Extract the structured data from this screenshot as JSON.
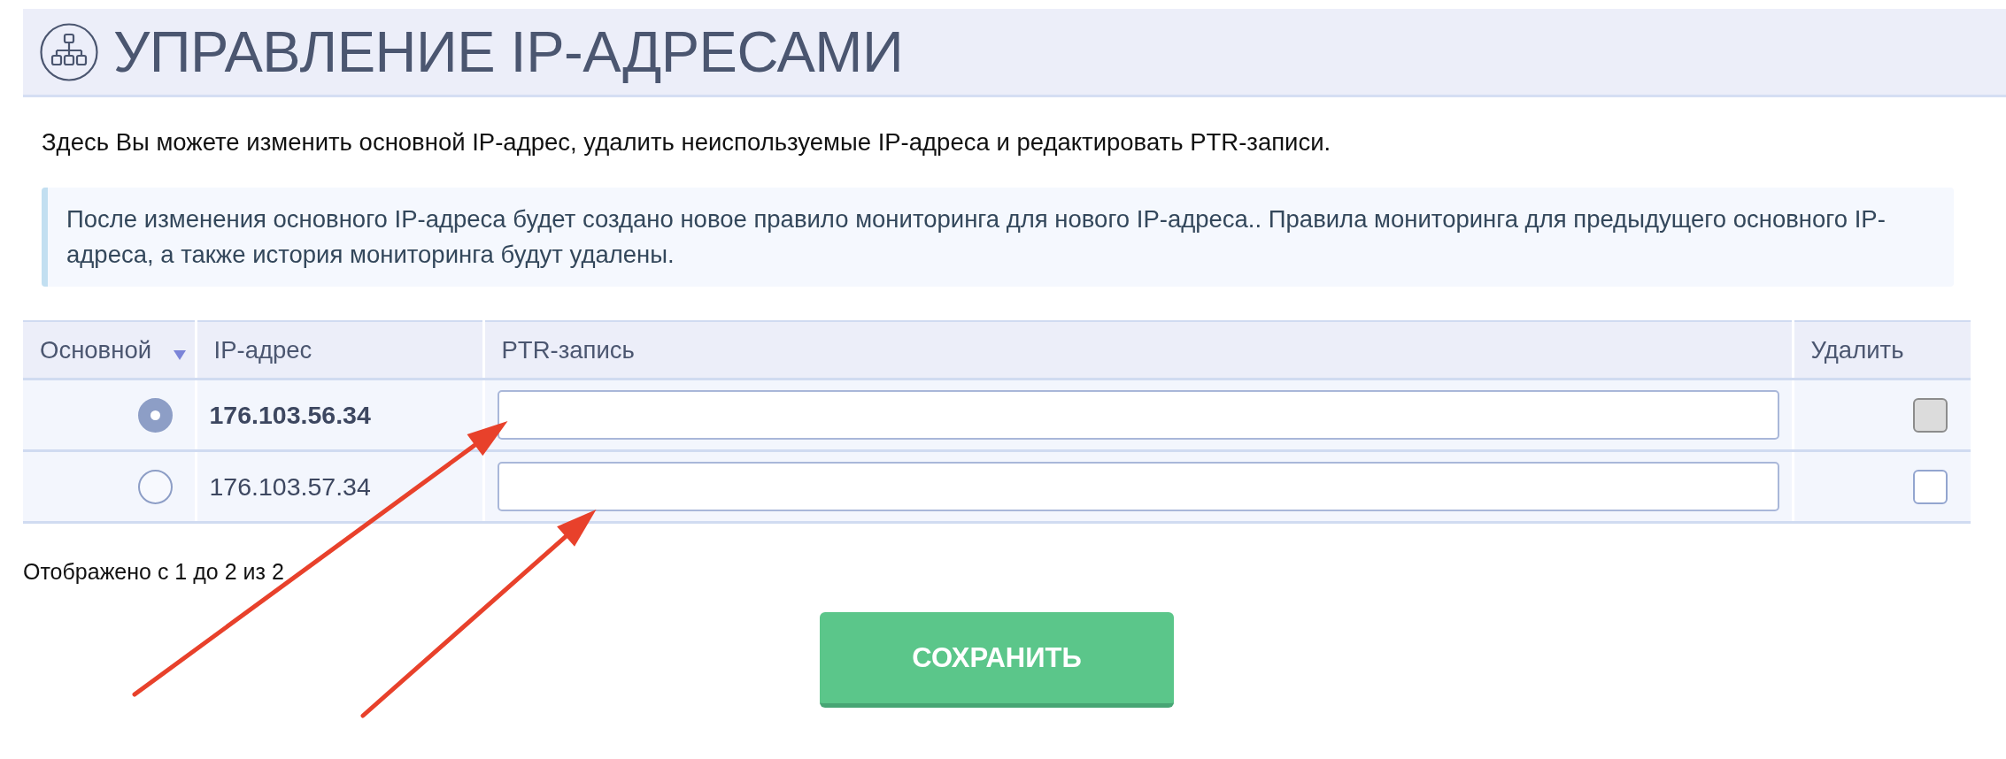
{
  "header": {
    "title": "УПРАВЛЕНИЕ IP-АДРЕСАМИ"
  },
  "description": "Здесь Вы можете изменить основной IP-адрес, удалить неиспользуемые IP-адреса и редактировать PTR-записи.",
  "notice": "После изменения основного IP-адреса будет создано новое правило мониторинга для нового IP-адреса.. Правила мониторинга для предыдущего основного IP-адреса, а также история мониторинга будут удалены.",
  "table": {
    "columns": [
      {
        "label": "Основной",
        "sorted": true
      },
      {
        "label": "IP-адрес",
        "sorted": false
      },
      {
        "label": "PTR-запись",
        "sorted": false
      },
      {
        "label": "Удалить",
        "sorted": false
      }
    ],
    "rows": [
      {
        "selected": true,
        "ip": "176.103.56.34",
        "annotated": true,
        "delete": {
          "checked": false,
          "disabled": true
        }
      },
      {
        "selected": false,
        "ip": "176.103.57.34",
        "annotated": true,
        "delete": {
          "checked": false,
          "disabled": false
        }
      }
    ]
  },
  "footer": {
    "info": "Отображено с 1 до 2 из 2"
  },
  "buttons": [
    {
      "label": "СОХРАНИТЬ"
    }
  ]
}
